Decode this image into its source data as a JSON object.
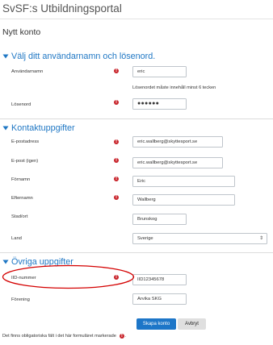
{
  "site": {
    "title": "SvSF:s Utbildningsportal"
  },
  "page": {
    "heading": "Nytt konto"
  },
  "sections": {
    "account": {
      "title": "Välj ditt användarnamn och lösenord."
    },
    "contact": {
      "title": "Kontaktuppgifter"
    },
    "other": {
      "title": "Övriga uppgifter"
    }
  },
  "fields": {
    "username": {
      "label": "Användarnamn",
      "value": "eric"
    },
    "password_hint": "Lösenordet måste innehåll minst 6 tecken",
    "password": {
      "label": "Lösenord",
      "value": "●●●●●●"
    },
    "email": {
      "label": "E-postadress",
      "value": "eric.wallberg@skyttesport.se"
    },
    "email_again": {
      "label": "E-post (igen)",
      "value": "eric.wallberg@skyttesport.se"
    },
    "firstname": {
      "label": "Förnamn",
      "value": "Eric"
    },
    "lastname": {
      "label": "Efternamn",
      "value": "Wallberg"
    },
    "city": {
      "label": "Stad/ort",
      "value": "Brunskog"
    },
    "country": {
      "label": "Land",
      "value": "Sverige"
    },
    "iid": {
      "label": "IID-nummer",
      "value": "IID12345678"
    },
    "club": {
      "label": "Förening",
      "value": "Arvika SKG"
    }
  },
  "required_mark": "!",
  "buttons": {
    "submit": "Skapa konto",
    "cancel": "Avbryt"
  },
  "footer": {
    "required_note": "Det finns obligatoriska fält i det här formuläret markerade",
    "trailing": "."
  },
  "icons": {
    "section_toggle": "chevron-down-icon",
    "required": "exclamation-circle-icon",
    "select": "sort-arrows-icon"
  },
  "colors": {
    "accent": "#1f77c4",
    "required": "#c8242b",
    "primary_button": "#1d76c8",
    "annotation": "#d40000"
  }
}
